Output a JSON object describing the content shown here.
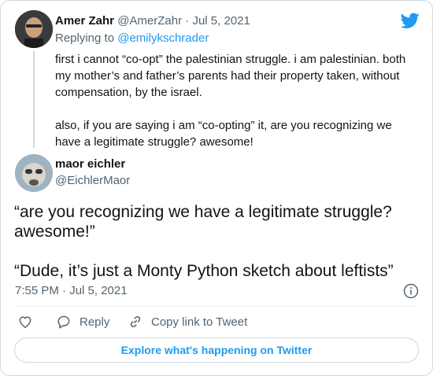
{
  "reply_tweet": {
    "author_name": "Amer Zahr",
    "author_handle": "@AmerZahr",
    "separator": "·",
    "date": "Jul 5, 2021",
    "replying_prefix": "Replying to",
    "replying_handle": "@emilykschrader",
    "paragraphs": [
      "first i cannot “co-opt” the palestinian struggle. i am palestinian. both my mother’s and father’s parents had their property taken, without compensation, by the israel.",
      "also, if you are saying i am “co-opting” it, are you recognizing we have a legitimate struggle? awesome!"
    ]
  },
  "main_tweet": {
    "author_name": "maor eichler",
    "author_handle": "@EichlerMaor",
    "paragraphs": [
      "“are you recognizing we have a legitimate struggle? awesome!”",
      "“Dude, it’s just a Monty Python sketch about leftists”"
    ],
    "timestamp": "7:55 PM · Jul 5, 2021"
  },
  "actions": {
    "reply_label": "Reply",
    "copy_link_label": "Copy link to Tweet"
  },
  "explore_label": "Explore what's happening on Twitter",
  "colors": {
    "brand": "#1d9bf0",
    "text": "#0f1419",
    "muted": "#536471",
    "border": "#cfd9de"
  }
}
